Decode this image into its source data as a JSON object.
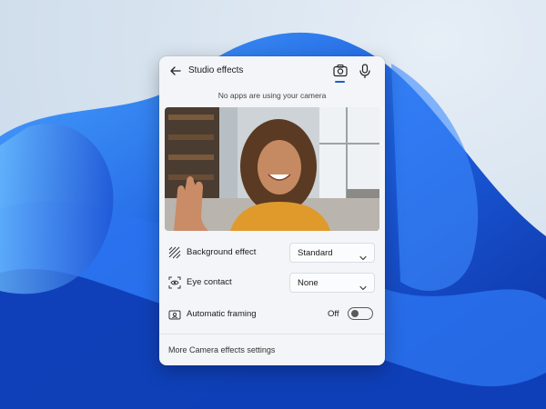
{
  "panel": {
    "title": "Studio effects",
    "status": "No apps are using your camera",
    "tabs": [
      {
        "name": "camera-icon",
        "active": true
      },
      {
        "name": "microphone-icon",
        "active": false
      }
    ],
    "accent_color": "#1a5fc7"
  },
  "settings": {
    "background_effect": {
      "label": "Background effect",
      "value": "Standard",
      "icon": "background-effect-icon"
    },
    "eye_contact": {
      "label": "Eye contact",
      "value": "None",
      "icon": "eye-contact-icon"
    },
    "automatic_framing": {
      "label": "Automatic framing",
      "state": "Off",
      "icon": "auto-framing-icon"
    }
  },
  "footer": {
    "link": "More Camera effects settings"
  }
}
